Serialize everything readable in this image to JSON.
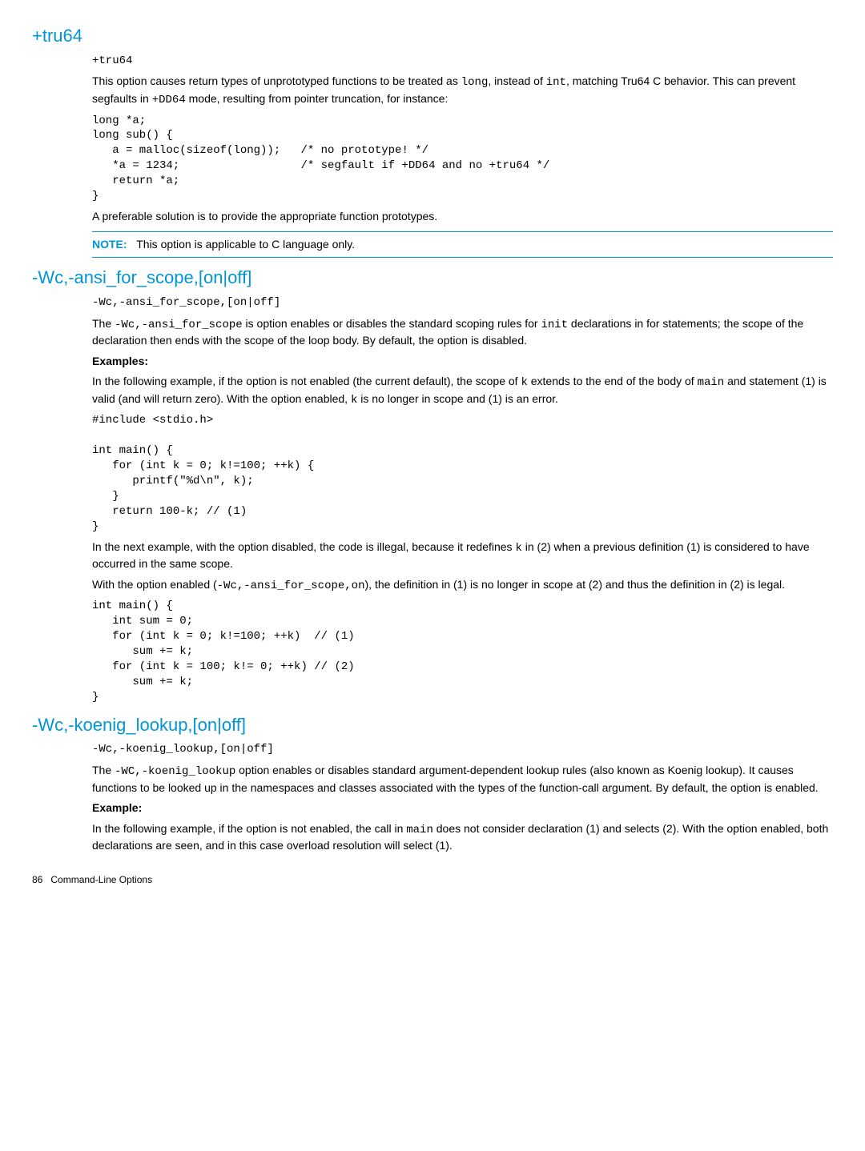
{
  "s1": {
    "heading": "+tru64",
    "sig": "+tru64",
    "p1a": "This option causes return types of unprototyped functions to be treated as ",
    "p1b": "long",
    "p1c": ", instead of ",
    "p1d": "int",
    "p1e": ", matching Tru64 C behavior. This can prevent segfaults in ",
    "p1f": "+DD64",
    "p1g": " mode, resulting from pointer truncation, for instance:",
    "code1": "long *a;\nlong sub() {\n   a = malloc(sizeof(long));   /* no prototype! */\n   *a = 1234;                  /* segfault if +DD64 and no +tru64 */\n   return *a;\n}",
    "p2": "A preferable solution is to provide the appropriate function prototypes.",
    "note_label": "NOTE:",
    "note_text": "This option is applicable to C language only."
  },
  "s2": {
    "heading": "-Wc,-ansi_for_scope,[on|off]",
    "sig": "-Wc,-ansi_for_scope,[on|off]",
    "p1a": "The ",
    "p1b": "-Wc,-ansi_for_scope",
    "p1c": " is option enables or disables the standard scoping rules for ",
    "p1d": "init",
    "p1e": " declarations in for statements; the scope of the declaration then ends with the scope of the loop body. By default, the option is disabled.",
    "examples_label": "Examples:",
    "p2a": "In the following example, if the option is not enabled (the current default), the scope of ",
    "p2b": "k",
    "p2c": " extends to the end of the body of ",
    "p2d": "main",
    "p2e": " and statement (1) is valid (and will return zero). With the option enabled, ",
    "p2f": "k",
    "p2g": " is no longer in scope and (1) is an error.",
    "code1": "#include <stdio.h>\n\nint main() {\n   for (int k = 0; k!=100; ++k) {\n      printf(\"%d\\n\", k);\n   }\n   return 100-k; // (1)\n}",
    "p3a": "In the next example, with the option disabled, the code is illegal, because it redefines ",
    "p3b": "k",
    "p3c": " in (2) when a previous definition (1) is considered to have occurred in the same scope.",
    "p4a": "With the option enabled (",
    "p4b": "-Wc,-ansi_for_scope,on",
    "p4c": "), the definition in (1) is no longer in scope at (2) and thus the definition in (2) is legal.",
    "code2": "int main() {\n   int sum = 0;\n   for (int k = 0; k!=100; ++k)  // (1)\n      sum += k;\n   for (int k = 100; k!= 0; ++k) // (2)\n      sum += k;\n}"
  },
  "s3": {
    "heading": "-Wc,-koenig_lookup,[on|off]",
    "sig": "-Wc,-koenig_lookup,[on|off]",
    "p1a": "The ",
    "p1b": "-WC,-koenig_lookup",
    "p1c": " option enables or disables standard argument-dependent lookup rules (also known as Koenig lookup). It causes functions to be looked up in the namespaces and classes associated with the types of the function-call argument. By default, the option is enabled.",
    "example_label": "Example:",
    "p2a": "In the following example, if the option is not enabled, the call in ",
    "p2b": "main",
    "p2c": " does not consider declaration (1) and selects (2). With the option enabled, both declarations are seen, and in this case overload resolution will select (1)."
  },
  "footer": {
    "page": "86",
    "section": "Command-Line Options"
  }
}
